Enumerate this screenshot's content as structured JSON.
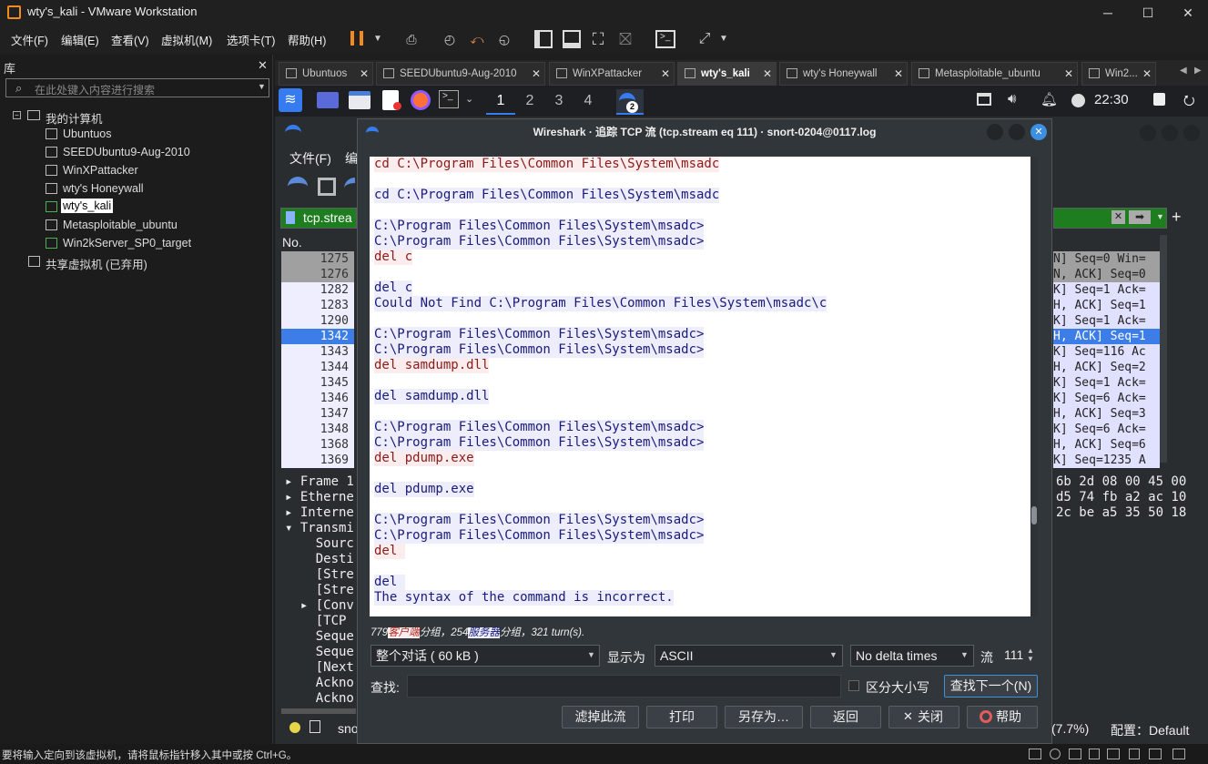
{
  "window": {
    "title": "wty's_kali - VMware Workstation",
    "minimize": "─",
    "maximize": "☐",
    "close": "✕"
  },
  "menu": [
    "文件(F)",
    "编辑(E)",
    "查看(V)",
    "虚拟机(M)",
    "选项卡(T)",
    "帮助(H)"
  ],
  "library": {
    "title": "库",
    "close": "✕",
    "search_placeholder": "在此处键入内容进行搜索",
    "root": "我的计算机",
    "vms": [
      "Ubuntuos",
      "SEEDUbuntu9-Aug-2010",
      "WinXPattacker",
      "wty's Honeywall",
      "wty's_kali",
      "Metasploitable_ubuntu",
      "Win2kServer_SP0_target"
    ],
    "selected": "wty's_kali",
    "shared": "共享虚拟机 (已弃用)"
  },
  "tabs": [
    "Ubuntuos",
    "SEEDUbuntu9-Aug-2010",
    "WinXPattacker",
    "wty's_kali",
    "wty's Honeywall",
    "Metasploitable_ubuntu",
    "Win2..."
  ],
  "active_tab": "wty's_kali",
  "kali": {
    "workspaces": [
      "1",
      "2",
      "3",
      "4"
    ],
    "active_workspace": "1",
    "clock": "22:30",
    "badge": "2"
  },
  "wireshark": {
    "menu_file": "文件(F)",
    "menu_edit": "编",
    "filter": "tcp.strea",
    "no_header": "No.",
    "rows": [
      "1275",
      "1276",
      "1282",
      "1283",
      "1290",
      "1342",
      "1343",
      "1344",
      "1345",
      "1346",
      "1347",
      "1348",
      "1368",
      "1369"
    ],
    "right_rows": [
      "N] Seq=0 Win=",
      "N, ACK] Seq=0",
      "K] Seq=1 Ack=",
      "H, ACK] Seq=1",
      "K] Seq=1 Ack=",
      "H, ACK] Seq=1",
      "K] Seq=116 Ac",
      "H, ACK] Seq=2",
      "K] Seq=1 Ack=",
      "K] Seq=6 Ack=",
      "H, ACK] Seq=3",
      "K] Seq=6 Ack=",
      "H, ACK] Seq=6",
      "K] Seq=1235 A"
    ],
    "selected_row": "1342",
    "details": [
      "▸ Frame 1",
      "▸ Etherne",
      "▸ Interne",
      "▾ Transmi",
      "    Sourc",
      "    Desti",
      "    [Stre",
      "    [Stre",
      "  ▸ [Conv",
      "    [TCP ",
      "    Seque",
      "    Seque",
      "    [Next",
      "    Ackno",
      "    Ackno"
    ],
    "hex": [
      "6b 2d 08 00 45 00",
      "d5 74 fb a2 ac 10",
      "2c be a5 35 50 18"
    ],
    "status_left": "sno",
    "status_pct": "(7.7%)",
    "status_profile": "配置：Default"
  },
  "dialog": {
    "title": "Wireshark · 追踪 TCP 流 (tcp.stream eq 111) · snort-0204@0117.log",
    "lines": [
      {
        "t": "cd C:\\Program Files\\Common Files\\System\\msadc",
        "k": "cli"
      },
      {
        "t": "",
        "k": ""
      },
      {
        "t": "cd C:\\Program Files\\Common Files\\System\\msadc",
        "k": "srv"
      },
      {
        "t": "",
        "k": ""
      },
      {
        "t": "C:\\Program Files\\Common Files\\System\\msadc>",
        "k": "srv"
      },
      {
        "t": "C:\\Program Files\\Common Files\\System\\msadc>",
        "k": "srv"
      },
      {
        "t": "del c",
        "k": "cli"
      },
      {
        "t": "",
        "k": ""
      },
      {
        "t": "del c",
        "k": "srv"
      },
      {
        "t": "Could Not Find C:\\Program Files\\Common Files\\System\\msadc\\c",
        "k": "srv"
      },
      {
        "t": "",
        "k": ""
      },
      {
        "t": "C:\\Program Files\\Common Files\\System\\msadc>",
        "k": "srv"
      },
      {
        "t": "C:\\Program Files\\Common Files\\System\\msadc>",
        "k": "srv"
      },
      {
        "t": "del samdump.dll",
        "k": "cli"
      },
      {
        "t": "",
        "k": ""
      },
      {
        "t": "del samdump.dll",
        "k": "srv"
      },
      {
        "t": "",
        "k": ""
      },
      {
        "t": "C:\\Program Files\\Common Files\\System\\msadc>",
        "k": "srv"
      },
      {
        "t": "C:\\Program Files\\Common Files\\System\\msadc>",
        "k": "srv"
      },
      {
        "t": "del pdump.exe",
        "k": "cli"
      },
      {
        "t": "",
        "k": ""
      },
      {
        "t": "del pdump.exe",
        "k": "srv"
      },
      {
        "t": "",
        "k": ""
      },
      {
        "t": "C:\\Program Files\\Common Files\\System\\msadc>",
        "k": "srv"
      },
      {
        "t": "C:\\Program Files\\Common Files\\System\\msadc>",
        "k": "srv"
      },
      {
        "t": "del ",
        "k": "cli"
      },
      {
        "t": "",
        "k": ""
      },
      {
        "t": "del ",
        "k": "srv"
      },
      {
        "t": "The syntax of the command is incorrect.",
        "k": "srv"
      }
    ],
    "summary": {
      "client_pkts": "779",
      "client_label": "客户端",
      "pkts_sep": "分组，",
      "server_pkts": "254",
      "server_label": "服务器",
      "turns": "分组，321 turn(s)."
    },
    "conversation": "整个对话 ( 60 kB )",
    "show_as_label": "显示为",
    "show_as": "ASCII",
    "delta": "No delta times",
    "stream_label": "流",
    "stream_value": "111",
    "find_label": "查找:",
    "case_label": "区分大小写",
    "find_next": "查找下一个(N)",
    "buttons": {
      "filter_out": "滤掉此流",
      "print": "打印",
      "save_as": "另存为…",
      "back": "返回",
      "close": "关闭",
      "help": "帮助"
    }
  },
  "statusbar": "要将输入定向到该虚拟机，请将鼠标指针移入其中或按 Ctrl+G。"
}
